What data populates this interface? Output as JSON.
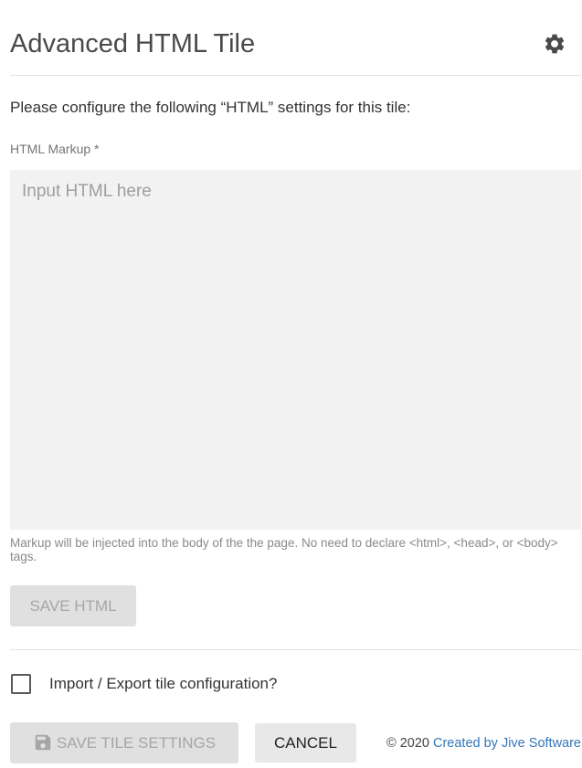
{
  "header": {
    "title": "Advanced HTML Tile",
    "settings_icon": "gear-icon"
  },
  "form": {
    "intro": "Please configure the following “HTML” settings for this tile:",
    "markup_label": "HTML Markup *",
    "markup_value": "",
    "markup_placeholder": "Input HTML here",
    "helper_text": "Markup will be injected into the body of the the page. No need to declare <html>, <head>, or <body> tags.",
    "save_html_label": "SAVE HTML",
    "import_export_label": "Import / Export tile configuration?",
    "import_export_checked": false
  },
  "actions": {
    "save_tile_icon": "floppy-disk-icon",
    "save_tile_label": "SAVE TILE SETTINGS",
    "cancel_label": "CANCEL"
  },
  "footer": {
    "copyright": "© 2020",
    "link_text": "Created by Jive Software"
  },
  "colors": {
    "link": "#3477b8",
    "disabled_text": "#a6a6a6",
    "button_bg": "#e0e0e0",
    "input_bg": "#f2f2f2"
  }
}
